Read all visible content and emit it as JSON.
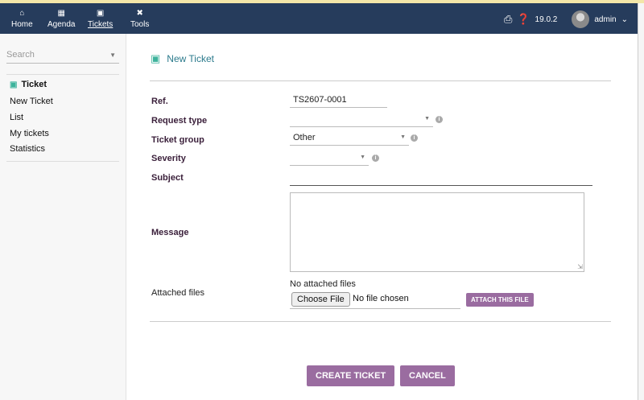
{
  "topbar": {
    "nav": [
      {
        "label": "Home",
        "icon": "home-icon"
      },
      {
        "label": "Agenda",
        "icon": "calendar-icon"
      },
      {
        "label": "Tickets",
        "icon": "ticket-icon"
      },
      {
        "label": "Tools",
        "icon": "tools-icon"
      }
    ],
    "version": "19.0.2",
    "user": "admin"
  },
  "sidebar": {
    "search_placeholder": "Search",
    "section_title": "Ticket",
    "items": [
      {
        "label": "New Ticket"
      },
      {
        "label": "List"
      },
      {
        "label": "My tickets"
      },
      {
        "label": "Statistics"
      }
    ]
  },
  "form": {
    "title": "New Ticket",
    "ref_label": "Ref.",
    "ref_value": "TS2607-0001",
    "request_type_label": "Request type",
    "request_type_value": "",
    "ticket_group_label": "Ticket group",
    "ticket_group_value": "Other",
    "severity_label": "Severity",
    "severity_value": "",
    "subject_label": "Subject",
    "message_label": "Message",
    "attached_files_label": "Attached files",
    "no_attached_files": "No attached files",
    "choose_file_label": "Choose File",
    "no_file_chosen": "No file chosen",
    "attach_button": "ATTACH THIS FILE"
  },
  "actions": {
    "create_label": "CREATE TICKET",
    "cancel_label": "CANCEL"
  },
  "colors": {
    "topbar": "#263c5c",
    "accent_button": "#9a6ca0",
    "ticket_icon": "#3db39c",
    "title_text": "#2b7a8c"
  }
}
